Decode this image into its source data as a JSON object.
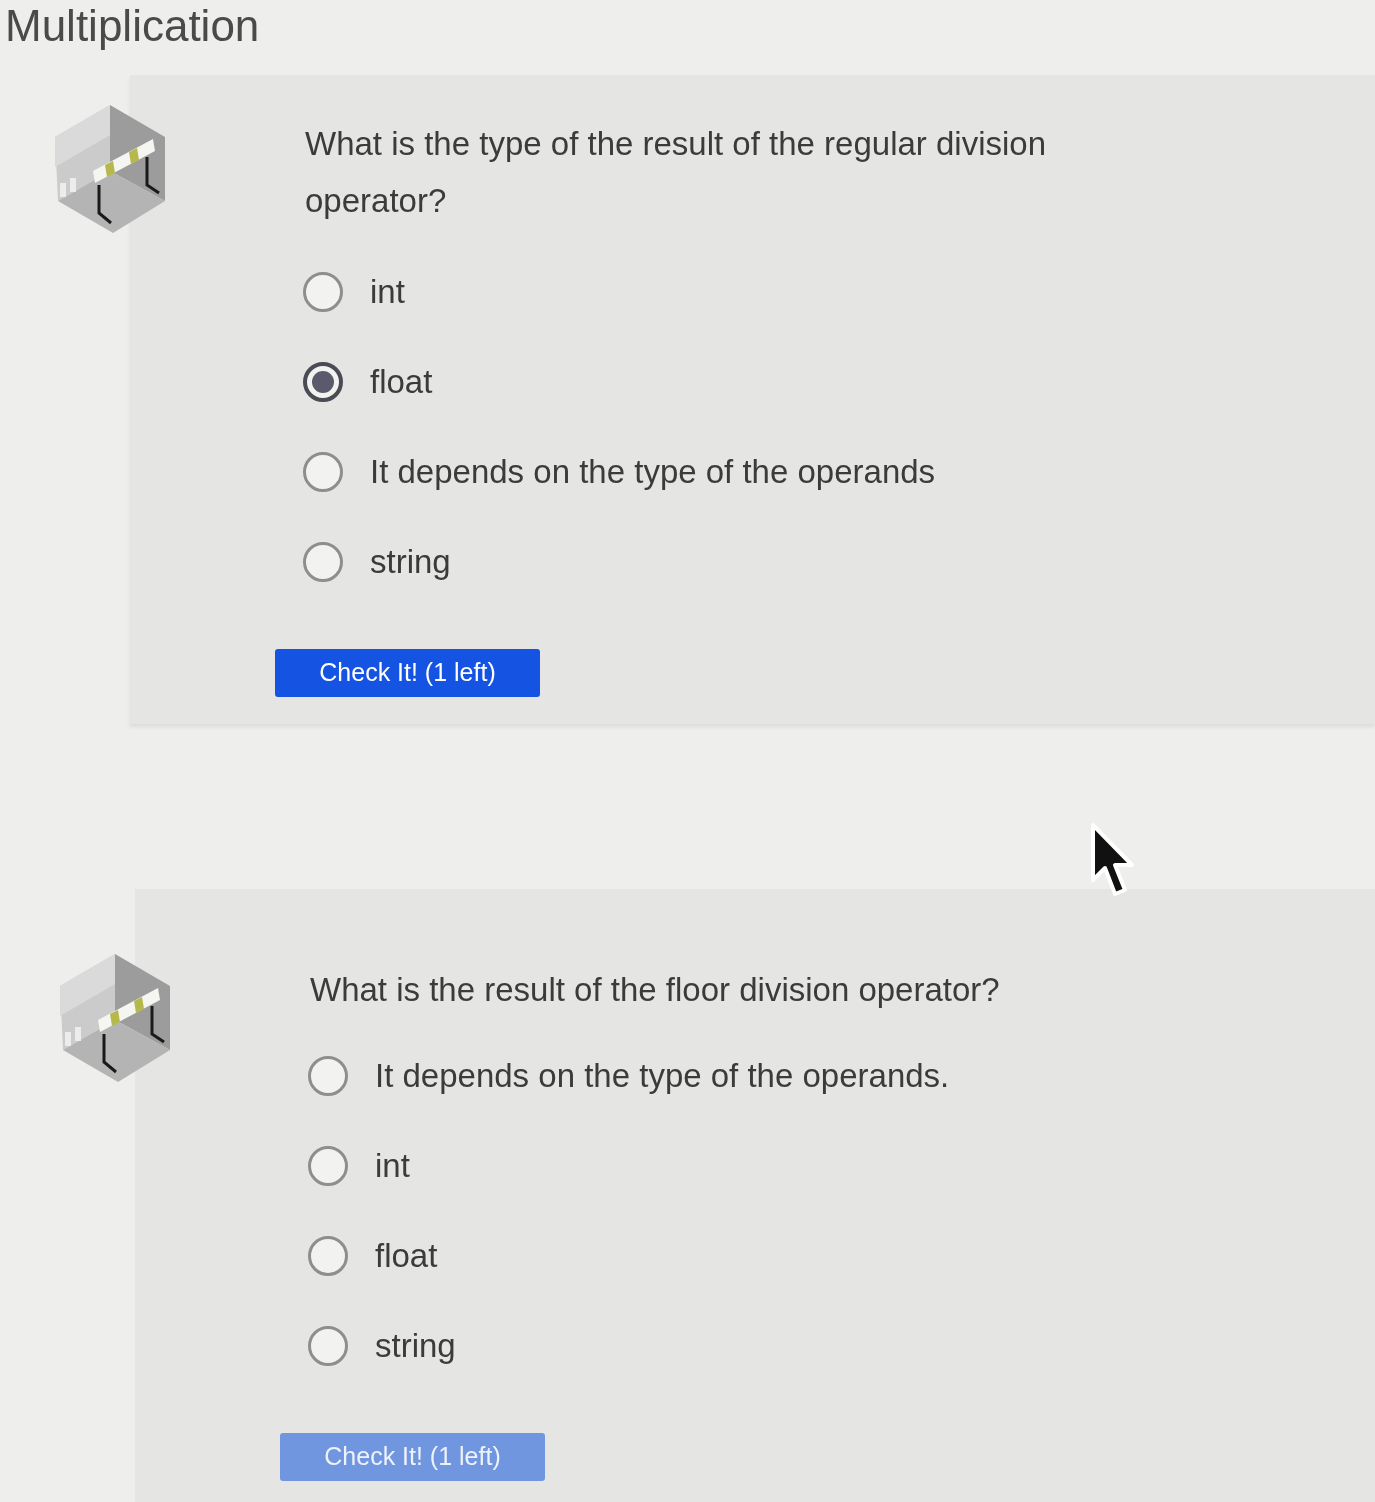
{
  "page": {
    "title": "Multiplication"
  },
  "questions": [
    {
      "prompt": "What is the type of the result of the regular division operator?",
      "options": [
        {
          "label": "int",
          "selected": false
        },
        {
          "label": "float",
          "selected": true
        },
        {
          "label": "It depends on the type of the operands",
          "selected": false
        },
        {
          "label": "string",
          "selected": false
        }
      ],
      "check_button": {
        "label": "Check It! (1 left)",
        "disabled": false
      }
    },
    {
      "prompt": "What is the result of the floor division operator?",
      "options": [
        {
          "label": "It depends on the type of the operands.",
          "selected": false
        },
        {
          "label": "int",
          "selected": false
        },
        {
          "label": "float",
          "selected": false
        },
        {
          "label": "string",
          "selected": false
        }
      ],
      "check_button": {
        "label": "Check It! (1 left)",
        "disabled": true
      }
    }
  ]
}
